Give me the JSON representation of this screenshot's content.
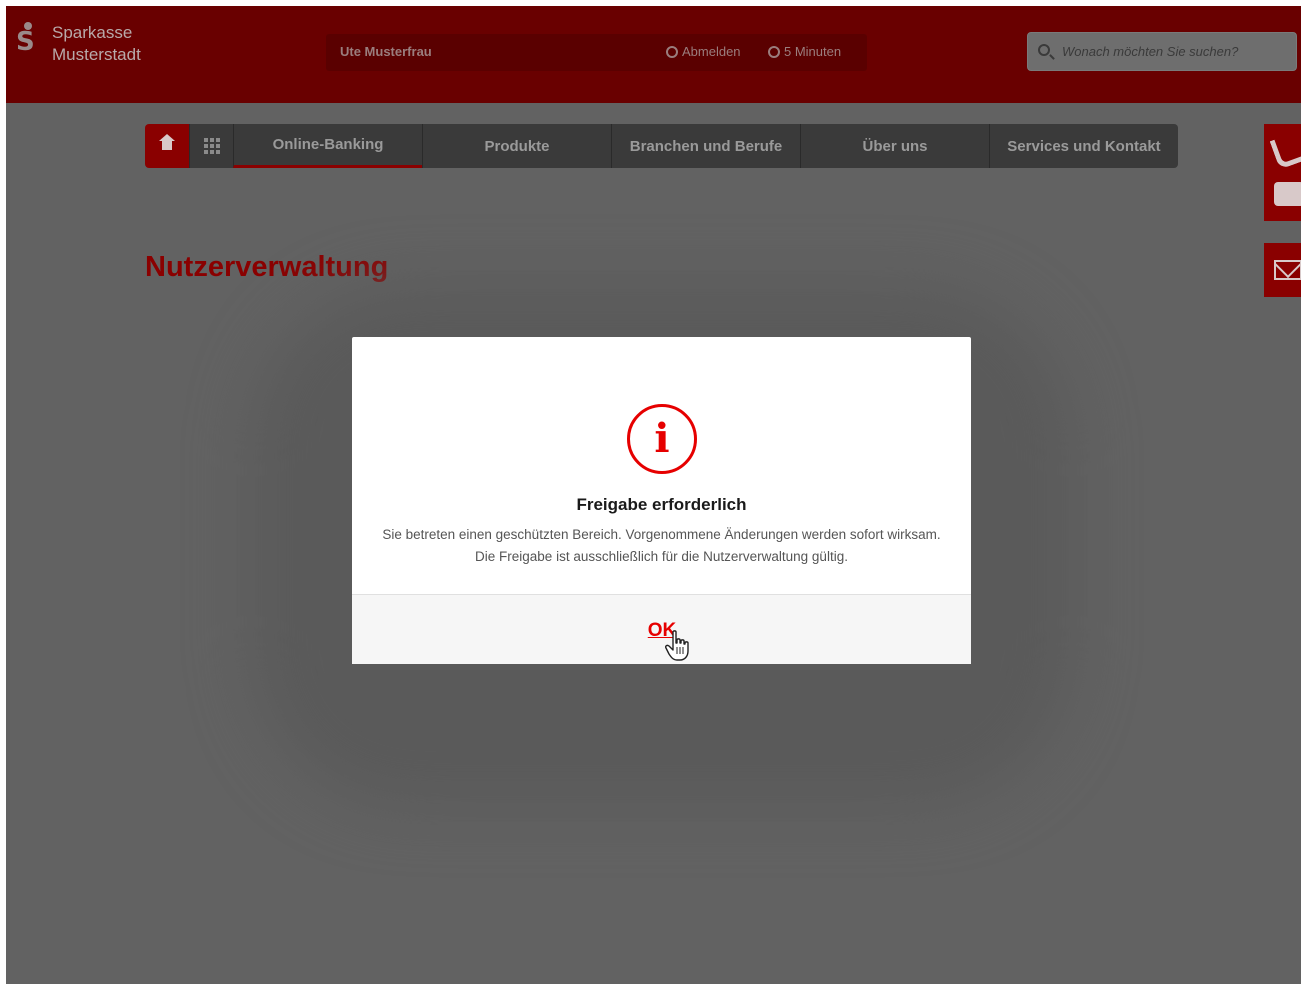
{
  "header": {
    "brand_line1": "Sparkasse",
    "brand_line2": "Musterstadt",
    "user_name": "Ute Musterfrau",
    "logout_label": "Abmelden",
    "session_timer": "5 Minuten",
    "search_placeholder": "Wonach möchten Sie suchen?"
  },
  "nav": {
    "items": [
      {
        "label": "Online-Banking"
      },
      {
        "label": "Produkte"
      },
      {
        "label": "Branchen und Berufe"
      },
      {
        "label": "Über uns"
      },
      {
        "label": "Services und Kontakt"
      }
    ]
  },
  "page": {
    "title": "Nutzerverwaltung"
  },
  "dialog": {
    "title": "Freigabe erforderlich",
    "text": "Sie betreten einen geschützten Bereich. Vorgenommene Änderungen werden sofort wirksam. Die Freigabe ist ausschließlich für die Nutzerverwaltung gültig.",
    "ok_label": "OK",
    "icon_glyph": "i"
  },
  "colors": {
    "brand_red": "#e60000",
    "header_bg": "#690000",
    "overlay": "#626262"
  }
}
